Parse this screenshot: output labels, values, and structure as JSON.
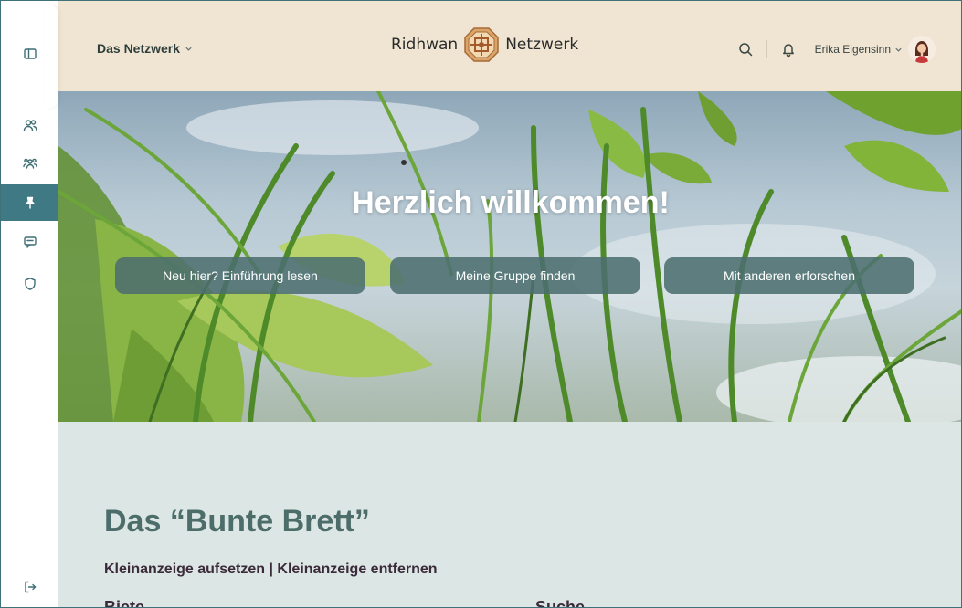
{
  "header": {
    "network_menu_label": "Das Netzwerk",
    "brand_left": "Ridhwan",
    "brand_right": "Netzwerk",
    "user_name": "Erika Eigensinn"
  },
  "rail": {
    "items": [
      {
        "icon": "sidebar-toggle-icon",
        "active": false
      },
      {
        "icon": "members-icon",
        "active": false
      },
      {
        "icon": "groups-icon",
        "active": false
      },
      {
        "icon": "pin-icon",
        "active": true
      },
      {
        "icon": "chat-icon",
        "active": false
      },
      {
        "icon": "shield-icon",
        "active": false
      },
      {
        "icon": "logout-icon",
        "active": false
      }
    ]
  },
  "hero": {
    "title": "Herzlich willkommen!",
    "buttons": [
      "Neu hier? Einführung lesen",
      "Meine Gruppe finden",
      "Mit anderen erforschen"
    ]
  },
  "board": {
    "title": "Das “Bunte Brett”",
    "link_create": "Kleinanzeige aufsetzen",
    "separator": "|",
    "link_remove": "Kleinanzeige entfernen",
    "col_offer": "Biete",
    "col_search": "Suche"
  },
  "colors": {
    "accent": "#3f7a84",
    "header_bg": "#efe5d2",
    "section_bg": "#dce6e4",
    "hero_button": "#4c6e70"
  }
}
